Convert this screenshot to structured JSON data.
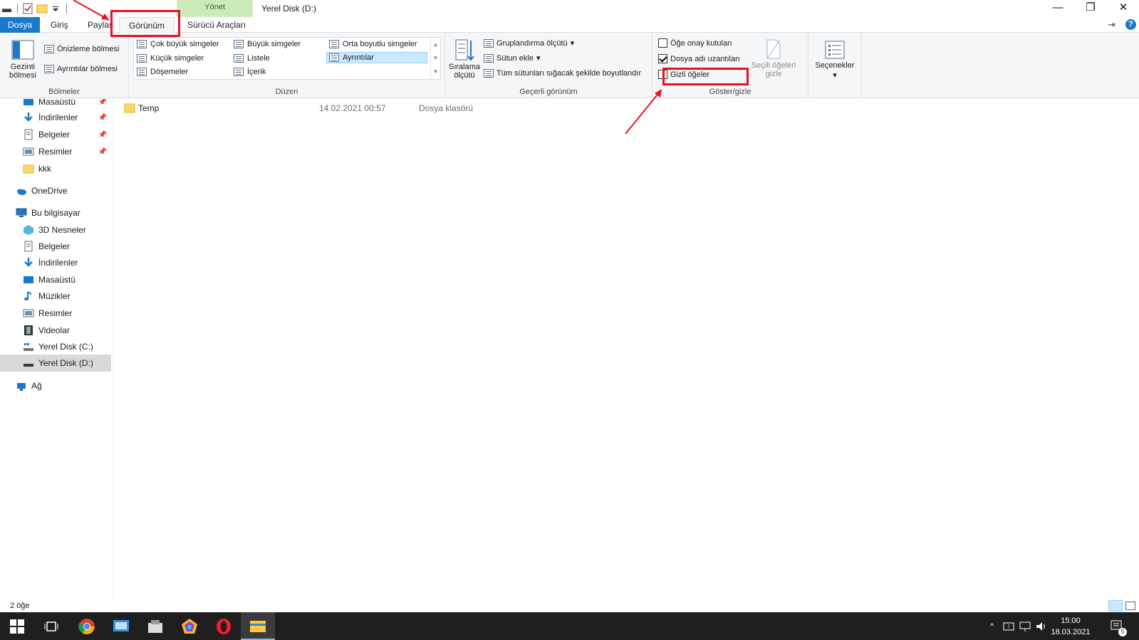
{
  "window": {
    "title": "Yerel Disk (D:)",
    "contextual_tab_group": "Yönet",
    "minimize": "—",
    "restore": "❐",
    "close": "✕"
  },
  "ribbon_tabs": {
    "file": "Dosya",
    "home": "Giriş",
    "share": "Paylaş",
    "view": "Görünüm",
    "drive_tools": "Sürücü Araçları"
  },
  "panes": {
    "label": "Bölmeler",
    "navigation_pane": "Gezinti bölmesi",
    "preview_pane": "Önizleme bölmesi",
    "details_pane": "Ayrıntılar bölmesi"
  },
  "layout": {
    "label": "Düzen",
    "items": [
      "Çok büyük simgeler",
      "Büyük simgeler",
      "Orta boyutlu simgeler",
      "Küçük simgeler",
      "Listele",
      "Ayrıntılar",
      "Döşemeler",
      "İçerik"
    ],
    "selected": "Ayrıntılar"
  },
  "current_view": {
    "label": "Geçerli görünüm",
    "sort_by": "Sıralama ölçütü",
    "group_by": "Gruplandırma ölçütü",
    "add_columns": "Sütun ekle",
    "size_all_columns": "Tüm sütunları sığacak şekilde boyutlandır"
  },
  "show_hide": {
    "label": "Göster/gizle",
    "item_check_boxes": "Öğe onay kutuları",
    "item_check_boxes_checked": false,
    "file_name_extensions": "Dosya adı uzantıları",
    "file_name_extensions_checked": true,
    "hidden_items": "Gizli öğeler",
    "hidden_items_checked": false,
    "hide_selected_items": "Seçili öğeleri gizle"
  },
  "options": {
    "label": "Seçenekler"
  },
  "nav": {
    "quick_access": [
      {
        "label": "Masaüstü",
        "pinned": true
      },
      {
        "label": "İndirilenler",
        "pinned": true
      },
      {
        "label": "Belgeler",
        "pinned": true
      },
      {
        "label": "Resimler",
        "pinned": true
      },
      {
        "label": "kkk",
        "pinned": false
      }
    ],
    "onedrive": "OneDrive",
    "this_pc": "Bu bilgisayar",
    "pc_items": [
      "3D Nesneler",
      "Belgeler",
      "İndirilenler",
      "Masaüstü",
      "Müzikler",
      "Resimler",
      "Videolar",
      "Yerel Disk (C:)",
      "Yerel Disk (D:)"
    ],
    "network": "Ağ"
  },
  "files": [
    {
      "name": "Temp",
      "modified": "14.02.2021 00:57",
      "type": "Dosya klasörü"
    }
  ],
  "status": {
    "item_count": "2 öğe"
  },
  "taskbar": {
    "time": "15:00",
    "date": "18.03.2021",
    "notification_count": "5"
  },
  "colors": {
    "accent": "#1979ca",
    "annotation": "#e81123",
    "manage_tab_bg": "#cdebb8"
  }
}
